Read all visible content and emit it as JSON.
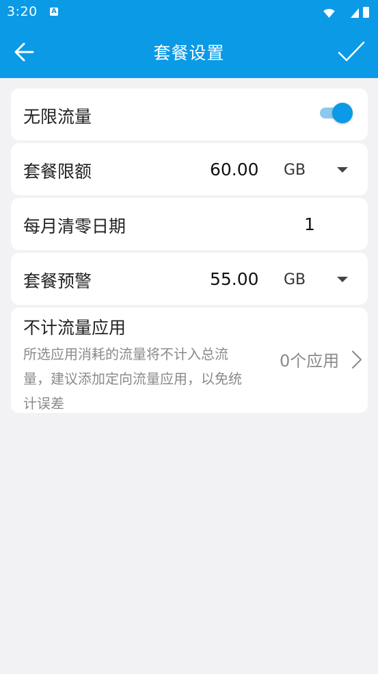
{
  "status_bar": {
    "time": "3:20",
    "notification_icon": "a-badge-icon"
  },
  "app_bar": {
    "title": "套餐设置",
    "back_icon": "arrow-left-icon",
    "confirm_icon": "checkmark-icon",
    "color": "#0a9ae6"
  },
  "settings": {
    "unlimited": {
      "label": "无限流量",
      "enabled": true
    },
    "quota": {
      "label": "套餐限额",
      "value": "60.00",
      "unit": "GB"
    },
    "reset_day": {
      "label": "每月清零日期",
      "value": "1"
    },
    "warning": {
      "label": "套餐预警",
      "value": "55.00",
      "unit": "GB"
    },
    "excluded_apps": {
      "label": "不计流量应用",
      "description": "所选应用消耗的流量将不计入总流量，建议添加定向流量应用，以免统计误差",
      "count": "0个应用"
    }
  }
}
